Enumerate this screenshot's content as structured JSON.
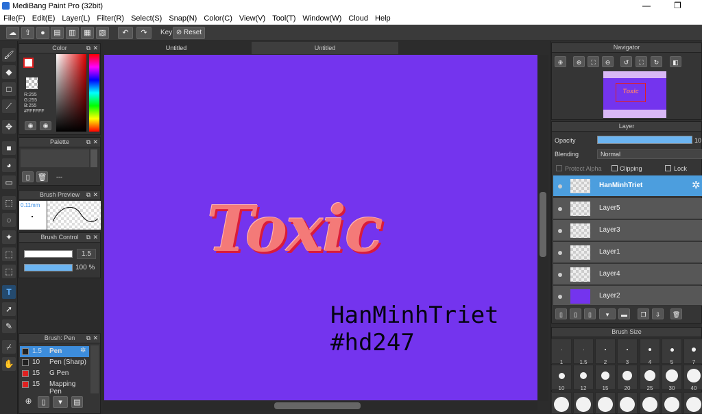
{
  "window": {
    "title": "MediBang Paint Pro (32bit)"
  },
  "menu": [
    "File(F)",
    "Edit(E)",
    "Layer(L)",
    "Filter(R)",
    "Select(S)",
    "Snap(N)",
    "Color(C)",
    "View(V)",
    "Tool(T)",
    "Window(W)",
    "Cloud",
    "Help"
  ],
  "toolbar": {
    "key_label": "Key",
    "reset_label": "Reset"
  },
  "tabs": [
    "Untitled",
    "Untitled"
  ],
  "color_panel": {
    "title": "Color",
    "r": "R:255",
    "g": "G:255",
    "b": "B:255",
    "hex": "#FFFFFF"
  },
  "palette_panel": {
    "title": "Palette",
    "value": "---"
  },
  "brush_preview": {
    "title": "Brush Preview",
    "size": "0.11mm"
  },
  "brush_control": {
    "title": "Brush Control",
    "size_value": "1.5",
    "opacity_value": "100 %"
  },
  "brush_panel": {
    "title": "Brush: Pen",
    "items": [
      {
        "size": "1.5",
        "name": "Pen",
        "color": "#f2f2f2",
        "selected": true
      },
      {
        "size": "10",
        "name": "Pen (Sharp)",
        "color": "#f2f2f2",
        "selected": false
      },
      {
        "size": "15",
        "name": "G Pen",
        "color": "#e02020",
        "selected": false
      },
      {
        "size": "15",
        "name": "Mapping Pen",
        "color": "#e02020",
        "selected": false
      }
    ]
  },
  "canvas": {
    "headline": "Toxic",
    "line1": "HanMinhTriet",
    "line2": "#hd247",
    "bg_color": "#7434ee",
    "headline_color": "#f47a78"
  },
  "navigator": {
    "title": "Navigator",
    "thumb_text": "Toxic"
  },
  "layer_panel": {
    "title": "Layer",
    "opacity_label": "Opacity",
    "opacity_value": "10",
    "blending_label": "Blending",
    "blending_value": "Normal",
    "protect_alpha": "Protect Alpha",
    "clipping": "Clipping",
    "lock": "Lock",
    "layers": [
      {
        "name": "HanMinhTriet",
        "selected": true
      },
      {
        "name": "Layer5",
        "selected": false
      },
      {
        "name": "Layer3",
        "selected": false
      },
      {
        "name": "Layer1",
        "selected": false
      },
      {
        "name": "Layer4",
        "selected": false
      },
      {
        "name": "Layer2",
        "selected": false
      }
    ]
  },
  "brush_size_panel": {
    "title": "Brush Size",
    "sizes": [
      "1",
      "1.5",
      "2",
      "3",
      "4",
      "5",
      "7",
      "10",
      "12",
      "15",
      "20",
      "25",
      "30",
      "40"
    ]
  }
}
